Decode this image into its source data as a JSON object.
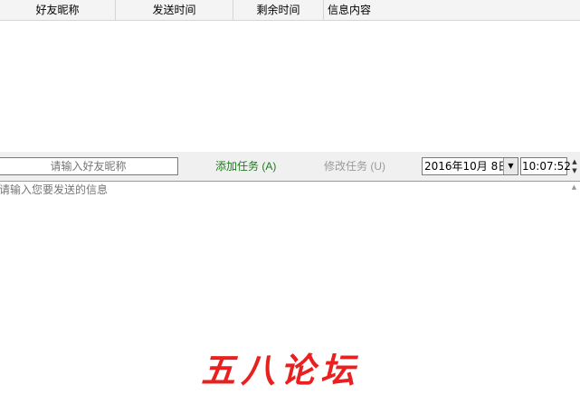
{
  "table": {
    "columns": [
      "好友昵称",
      "发送时间",
      "剩余时间",
      "信息内容"
    ],
    "rows": []
  },
  "toolbar": {
    "friend_placeholder": "请输入好友昵称",
    "add_task_label": "添加任务 (A)",
    "edit_task_label": "修改任务 (U)",
    "date_value": "2016年10月 8日",
    "time_value": "10:07:52",
    "dropdown_icon": "chevron-down-icon",
    "spin_icons": [
      "spin-up-icon",
      "spin-down-icon"
    ]
  },
  "message": {
    "placeholder": "请输入您要发送的信息"
  },
  "watermark": "五八论坛",
  "colors": {
    "add_task": "#1f7a1f",
    "edit_task_disabled": "#9a9a9a",
    "watermark": "#e8201f"
  }
}
